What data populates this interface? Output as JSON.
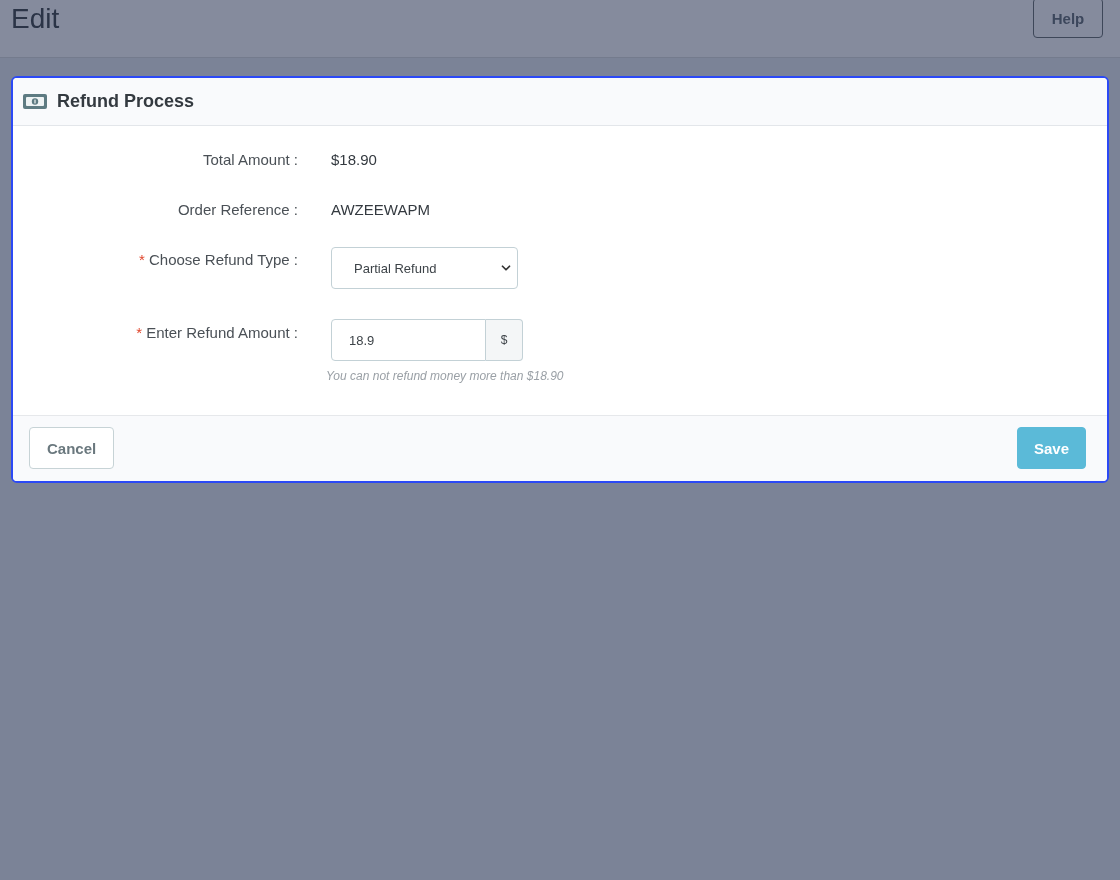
{
  "page": {
    "title": "Edit",
    "help_button": "Help"
  },
  "modal": {
    "title": "Refund Process",
    "fields": [
      {
        "kind": "text",
        "label": "Total Amount :",
        "value": "$18.90"
      },
      {
        "kind": "text",
        "label": "Order Reference :",
        "value": "AWZEEWAPM"
      },
      {
        "kind": "select",
        "required_mark": "*",
        "label": "Choose Refund Type :",
        "value": "Partial Refund"
      },
      {
        "kind": "input",
        "required_mark": "*",
        "label": "Enter Refund Amount :",
        "value": "18.9",
        "addon": "$",
        "help": "You can not refund money more than $18.90"
      }
    ],
    "buttons": [
      {
        "kind": "secondary",
        "label": "Cancel"
      },
      {
        "kind": "primary",
        "label": "Save"
      }
    ]
  }
}
